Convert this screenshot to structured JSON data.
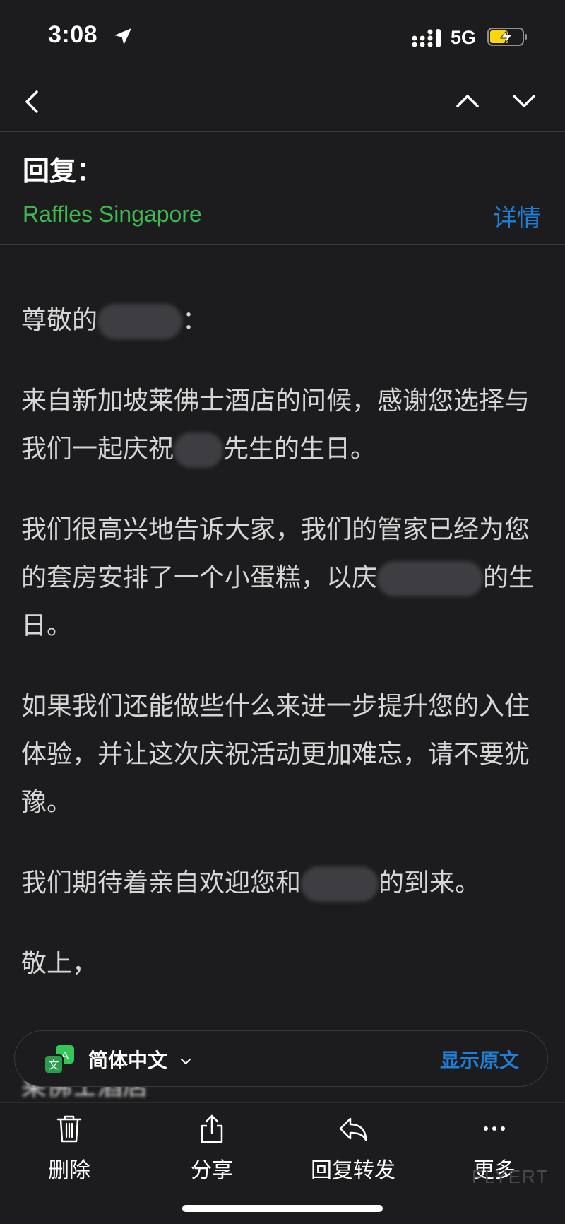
{
  "status_bar": {
    "time": "3:08",
    "network": "5G",
    "battery_color": "#ffd60a"
  },
  "nav": {
    "back_icon": "chevron-left-icon",
    "prev_icon": "chevron-up-icon",
    "next_icon": "chevron-down-icon"
  },
  "header": {
    "subject": "回复：",
    "sender": "Raffles Singapore",
    "details_label": "详情",
    "sender_color": "#3fb950",
    "link_color": "#1e7fd6"
  },
  "body": {
    "greeting_prefix": "尊敬的",
    "greeting_suffix": "：",
    "p1_a": "来自新加坡莱佛士酒店的问候，感谢您选择与我们一起庆祝",
    "p1_b": "先生的生日。",
    "p2_a": "我们很高兴地告诉大家，我们的管家已经为您的套房安排了一个小蛋糕，以庆",
    "p2_b": "的生日。",
    "p3": "如果我们还能做些什么来进一步提升您的入住体验，并让这次庆祝活动更加难忘，请不要犹豫。",
    "p4_a": "我们期待着亲自欢迎您和",
    "p4_b": "的到来。",
    "closing": "敬上，"
  },
  "translate": {
    "language": "简体中文",
    "show_original_label": "显示原文"
  },
  "toolbar": {
    "delete_label": "删除",
    "share_label": "分享",
    "reply_label": "回复转发",
    "more_label": "更多"
  },
  "watermark": {
    "text": "FLYERT"
  }
}
